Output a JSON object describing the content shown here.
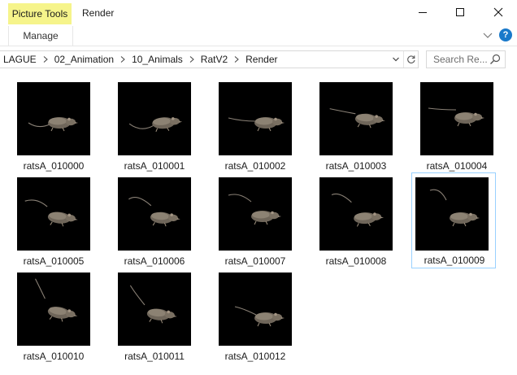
{
  "ribbon": {
    "context_group_label": "Picture Tools",
    "context_tab_label": "Manage",
    "window_title": "Render",
    "help_label": "?"
  },
  "address": {
    "crumbs": [
      "LAGUE",
      "02_Animation",
      "10_Animals",
      "RatV2",
      "Render"
    ]
  },
  "search": {
    "placeholder": "Search Re..."
  },
  "files": [
    {
      "name": "ratsA_010000",
      "selected": false
    },
    {
      "name": "ratsA_010001",
      "selected": false
    },
    {
      "name": "ratsA_010002",
      "selected": false
    },
    {
      "name": "ratsA_010003",
      "selected": false
    },
    {
      "name": "ratsA_010004",
      "selected": false
    },
    {
      "name": "ratsA_010005",
      "selected": false
    },
    {
      "name": "ratsA_010006",
      "selected": false
    },
    {
      "name": "ratsA_010007",
      "selected": false
    },
    {
      "name": "ratsA_010008",
      "selected": false
    },
    {
      "name": "ratsA_010009",
      "selected": true
    },
    {
      "name": "ratsA_010010",
      "selected": false
    },
    {
      "name": "ratsA_010011",
      "selected": false
    },
    {
      "name": "ratsA_010012",
      "selected": false
    }
  ],
  "colors": {
    "context_tab": "#f6f48b",
    "selection_border": "#99d1ff",
    "thumbnail_background": "#000000"
  },
  "icons": {
    "minimize": "minimize-icon",
    "maximize": "maximize-icon",
    "close": "close-icon",
    "ribbon_expand": "chevron-down-icon",
    "help": "help-icon",
    "address_dropdown": "chevron-down-icon",
    "refresh": "refresh-icon",
    "search": "search-icon",
    "breadcrumb_separator": "chevron-right-icon"
  }
}
